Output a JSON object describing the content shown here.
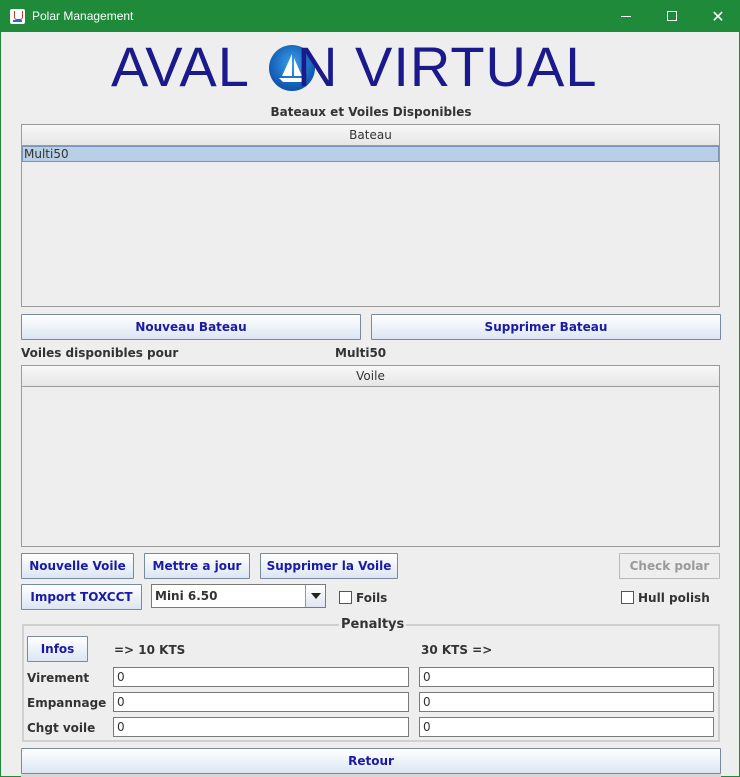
{
  "window": {
    "title": "Polar Management"
  },
  "logo": {
    "left": "AVAL",
    "right": "N VIRTUAL"
  },
  "boats_section": {
    "title": "Bateaux et Voiles Disponibles",
    "column": "Bateau",
    "rows": [
      "Multi50"
    ]
  },
  "boat_buttons": {
    "new": "Nouveau Bateau",
    "delete": "Supprimer Bateau"
  },
  "sails_section": {
    "label": "Voiles disponibles pour",
    "selected_boat": "Multi50",
    "column": "Voile",
    "rows": []
  },
  "sail_buttons": {
    "new": "Nouvelle Voile",
    "update": "Mettre a jour",
    "delete": "Supprimer la Voile",
    "check": "Check polar",
    "import": "Import TOXCCT"
  },
  "sail_type": {
    "selected": "Mini 6.50"
  },
  "options": {
    "foils": "Foils",
    "foils_checked": false,
    "hull_polish": "Hull polish",
    "hull_polish_checked": false
  },
  "penalties": {
    "legend": "Penaltys",
    "infos_button": "Infos",
    "low_header": "=> 10 KTS",
    "high_header": "30 KTS =>",
    "rows": [
      {
        "label": "Virement",
        "low": "0",
        "high": "0"
      },
      {
        "label": "Empannage",
        "low": "0",
        "high": "0"
      },
      {
        "label": "Chgt voile",
        "low": "0",
        "high": "0"
      }
    ]
  },
  "footer": {
    "back_button": "Retour"
  }
}
